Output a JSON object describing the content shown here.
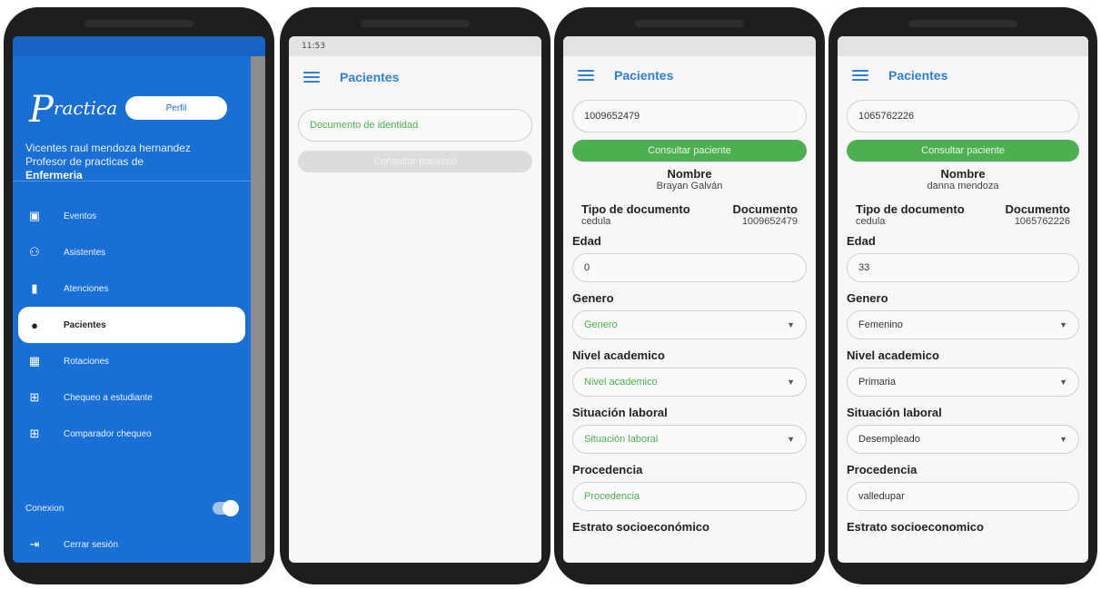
{
  "phone1": {
    "statusbar": {
      "left": "",
      "right": ""
    },
    "logo": "Practica",
    "perfil_label": "Perfil",
    "close_icon": "close-icon",
    "user_line1": "Vicentes raul mendoza hernandez",
    "user_line2": "Profesor de practicas de",
    "user_line3": "Enfermeria",
    "menu": [
      {
        "label": "Eventos",
        "icon": "calendar-icon"
      },
      {
        "label": "Asistentes",
        "icon": "group-icon"
      },
      {
        "label": "Atenciones",
        "icon": "document-icon"
      },
      {
        "label": "Pacientes",
        "icon": "person-icon"
      },
      {
        "label": "Rotaciones",
        "icon": "rotation-icon"
      },
      {
        "label": "Chequeo a estudiante",
        "icon": "checklist-icon"
      },
      {
        "label": "Comparador chequeo",
        "icon": "compare-icon"
      }
    ],
    "connection_label": "Conexion",
    "logout_label": "Cerrar sesión"
  },
  "phone2": {
    "statusbar": {
      "time": "11:53",
      "right": ""
    },
    "title": "Pacientes",
    "id_placeholder": "Documento de identidad",
    "consult_label": "Consultar paciente"
  },
  "phone3": {
    "statusbar": {
      "time": "",
      "right": ""
    },
    "title": "Pacientes",
    "id_value": "1009652479",
    "consult_label": "Consultar paciente",
    "nombre_label": "Nombre",
    "nombre_value": "Brayan Galván",
    "tipo_doc_label": "Tipo de documento",
    "tipo_doc_value": "cedula",
    "doc_label": "Documento",
    "doc_value": "1009652479",
    "edad_label": "Edad",
    "edad_value": "0",
    "genero_label": "Genero",
    "genero_value": "Genero",
    "nivel_label": "Nivel academico",
    "nivel_value": "Nivel academico",
    "situacion_label": "Situación laboral",
    "situacion_value": "Situación laboral",
    "procedencia_label": "Procedencia",
    "procedencia_value": "Procedencia",
    "estrato_label": "Estrato socioeconómico"
  },
  "phone4": {
    "statusbar": {
      "time": "",
      "right": ""
    },
    "title": "Pacientes",
    "id_value": "1065762226",
    "consult_label": "Consultar paciente",
    "nombre_label": "Nombre",
    "nombre_value": "danna mendoza",
    "tipo_doc_label": "Tipo de documento",
    "tipo_doc_value": "cedula",
    "doc_label": "Documento",
    "doc_value": "1065762226",
    "edad_label": "Edad",
    "edad_value": "33",
    "genero_label": "Genero",
    "genero_value": "Femenino",
    "nivel_label": "Nivel academico",
    "nivel_value": "Primaria",
    "situacion_label": "Situación laboral",
    "situacion_value": "Desempleado",
    "procedencia_label": "Procedencia",
    "procedencia_value": "valledupar",
    "estrato_label": "Estrato socioeconomico"
  },
  "colors": {
    "primary_blue": "#1a6fd6",
    "accent_green": "#4caf50",
    "title_blue": "#2f7ed8"
  }
}
